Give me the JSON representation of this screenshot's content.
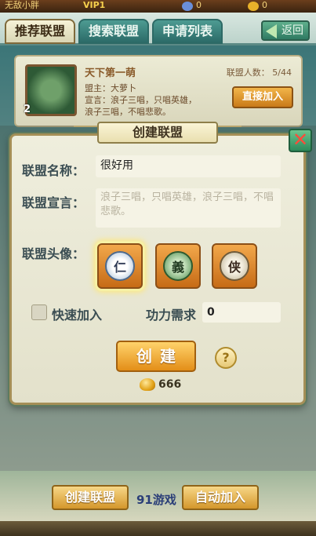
{
  "topbar": {
    "player": "无敌小胖",
    "vip": "VIP1",
    "gem_count": "0",
    "gold_count": "0"
  },
  "tabs": [
    {
      "label": "推荐联盟",
      "active": true
    },
    {
      "label": "搜索联盟",
      "active": false
    },
    {
      "label": "申请列表",
      "active": false
    }
  ],
  "back_label": "返回",
  "alliance_card": {
    "name": "天下第一萌",
    "leader": "盟主：大萝卜",
    "motto": "宣言：浪子三唱，只唱英雄，浪子三唱，不唱悲歌。",
    "member_count": "联盟人数： 5/44",
    "rank": "2",
    "join_label": "直接加入"
  },
  "modal": {
    "title": "创建联盟",
    "name_label": "联盟名称：",
    "name_value": "很好用",
    "motto_label": "联盟宣言：",
    "motto_placeholder": "浪子三唱，只唱英雄，浪子三唱，不唱悲歌。",
    "emblem_label": "联盟头像：",
    "emblems": [
      {
        "char": "仁",
        "icon": "ren-emblem-icon",
        "selected": true
      },
      {
        "char": "義",
        "icon": "yi-dragon-emblem-icon",
        "selected": false
      },
      {
        "char": "侠",
        "icon": "xia-swords-emblem-icon",
        "selected": false
      }
    ],
    "quick_join_label": "快速加入",
    "power_label": "功力需求",
    "power_value": "0",
    "create_label": "创建",
    "help_label": "?",
    "cost": "666"
  },
  "bottom": {
    "create_alliance": "创建联盟",
    "auto_join": "自动加入",
    "logo_text": "91游戏"
  },
  "colors": {
    "accent_orange": "#e38e18",
    "panel_bg": "#efeedd",
    "label_text": "#3a4d52",
    "close_x": "#ff4b3a"
  }
}
